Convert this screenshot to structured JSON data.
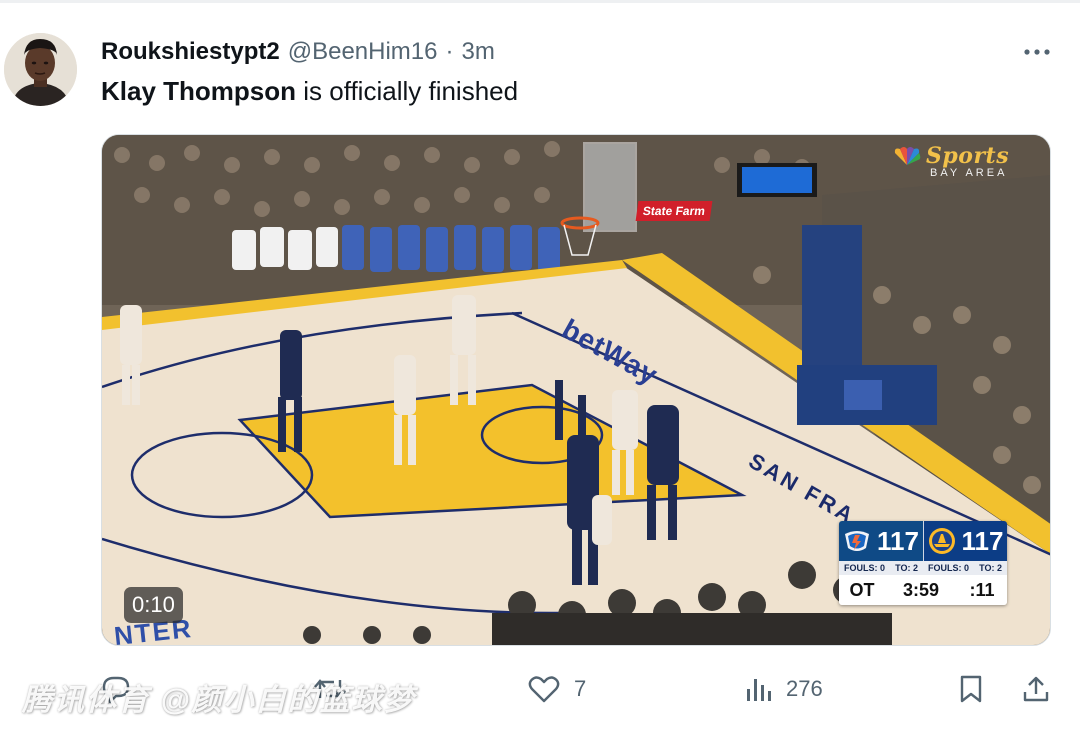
{
  "tweet": {
    "display_name": "Roukshiestypt2",
    "handle": "@BeenHim16",
    "separator": "·",
    "time": "3m",
    "text_bold": "Klay Thompson",
    "text_rest": " is officially finished",
    "more_icon": "more-horizontal-icon"
  },
  "media": {
    "duration": "0:10",
    "broadcaster": {
      "name": "Sports",
      "sub": "BAY AREA"
    },
    "sponsor_sign": "State Farm",
    "court_sponsor": "betWay",
    "court_city": "SAN FRA",
    "court_bottom": "NTER",
    "scoreboard": {
      "away_score": "117",
      "home_score": "117",
      "away_fouls": "FOULS: 0",
      "away_to": "TO: 2",
      "home_fouls": "FOULS: 0",
      "home_to": "TO: 2",
      "period": "OT",
      "clock": "3:59",
      "shot_clock": ":11",
      "colors": {
        "away": "#0f4a86",
        "home": "#0c3d86"
      }
    }
  },
  "actions": {
    "reply": {
      "icon": "reply-icon"
    },
    "retweet": {
      "icon": "retweet-icon"
    },
    "like": {
      "icon": "heart-icon",
      "count": "7"
    },
    "views": {
      "icon": "views-icon",
      "count": "276"
    },
    "bookmark": {
      "icon": "bookmark-icon"
    },
    "share": {
      "icon": "share-icon"
    }
  },
  "watermark": "腾讯体育 @颜小白的篮球梦"
}
